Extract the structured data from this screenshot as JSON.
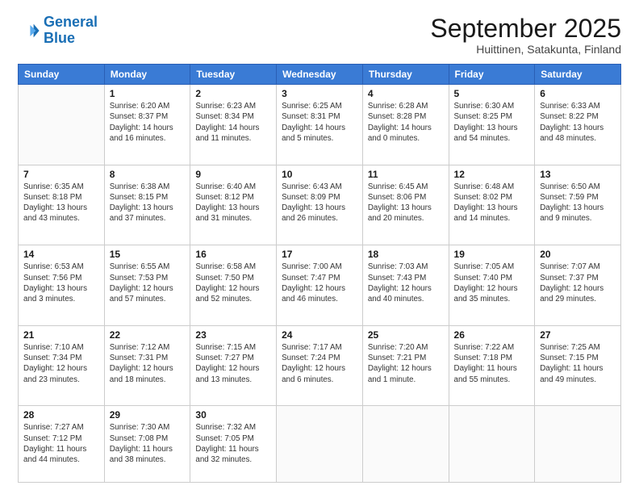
{
  "logo": {
    "line1": "General",
    "line2": "Blue"
  },
  "title": "September 2025",
  "subtitle": "Huittinen, Satakunta, Finland",
  "weekdays": [
    "Sunday",
    "Monday",
    "Tuesday",
    "Wednesday",
    "Thursday",
    "Friday",
    "Saturday"
  ],
  "weeks": [
    [
      {
        "day": "",
        "info": ""
      },
      {
        "day": "1",
        "info": "Sunrise: 6:20 AM\nSunset: 8:37 PM\nDaylight: 14 hours\nand 16 minutes."
      },
      {
        "day": "2",
        "info": "Sunrise: 6:23 AM\nSunset: 8:34 PM\nDaylight: 14 hours\nand 11 minutes."
      },
      {
        "day": "3",
        "info": "Sunrise: 6:25 AM\nSunset: 8:31 PM\nDaylight: 14 hours\nand 5 minutes."
      },
      {
        "day": "4",
        "info": "Sunrise: 6:28 AM\nSunset: 8:28 PM\nDaylight: 14 hours\nand 0 minutes."
      },
      {
        "day": "5",
        "info": "Sunrise: 6:30 AM\nSunset: 8:25 PM\nDaylight: 13 hours\nand 54 minutes."
      },
      {
        "day": "6",
        "info": "Sunrise: 6:33 AM\nSunset: 8:22 PM\nDaylight: 13 hours\nand 48 minutes."
      }
    ],
    [
      {
        "day": "7",
        "info": "Sunrise: 6:35 AM\nSunset: 8:18 PM\nDaylight: 13 hours\nand 43 minutes."
      },
      {
        "day": "8",
        "info": "Sunrise: 6:38 AM\nSunset: 8:15 PM\nDaylight: 13 hours\nand 37 minutes."
      },
      {
        "day": "9",
        "info": "Sunrise: 6:40 AM\nSunset: 8:12 PM\nDaylight: 13 hours\nand 31 minutes."
      },
      {
        "day": "10",
        "info": "Sunrise: 6:43 AM\nSunset: 8:09 PM\nDaylight: 13 hours\nand 26 minutes."
      },
      {
        "day": "11",
        "info": "Sunrise: 6:45 AM\nSunset: 8:06 PM\nDaylight: 13 hours\nand 20 minutes."
      },
      {
        "day": "12",
        "info": "Sunrise: 6:48 AM\nSunset: 8:02 PM\nDaylight: 13 hours\nand 14 minutes."
      },
      {
        "day": "13",
        "info": "Sunrise: 6:50 AM\nSunset: 7:59 PM\nDaylight: 13 hours\nand 9 minutes."
      }
    ],
    [
      {
        "day": "14",
        "info": "Sunrise: 6:53 AM\nSunset: 7:56 PM\nDaylight: 13 hours\nand 3 minutes."
      },
      {
        "day": "15",
        "info": "Sunrise: 6:55 AM\nSunset: 7:53 PM\nDaylight: 12 hours\nand 57 minutes."
      },
      {
        "day": "16",
        "info": "Sunrise: 6:58 AM\nSunset: 7:50 PM\nDaylight: 12 hours\nand 52 minutes."
      },
      {
        "day": "17",
        "info": "Sunrise: 7:00 AM\nSunset: 7:47 PM\nDaylight: 12 hours\nand 46 minutes."
      },
      {
        "day": "18",
        "info": "Sunrise: 7:03 AM\nSunset: 7:43 PM\nDaylight: 12 hours\nand 40 minutes."
      },
      {
        "day": "19",
        "info": "Sunrise: 7:05 AM\nSunset: 7:40 PM\nDaylight: 12 hours\nand 35 minutes."
      },
      {
        "day": "20",
        "info": "Sunrise: 7:07 AM\nSunset: 7:37 PM\nDaylight: 12 hours\nand 29 minutes."
      }
    ],
    [
      {
        "day": "21",
        "info": "Sunrise: 7:10 AM\nSunset: 7:34 PM\nDaylight: 12 hours\nand 23 minutes."
      },
      {
        "day": "22",
        "info": "Sunrise: 7:12 AM\nSunset: 7:31 PM\nDaylight: 12 hours\nand 18 minutes."
      },
      {
        "day": "23",
        "info": "Sunrise: 7:15 AM\nSunset: 7:27 PM\nDaylight: 12 hours\nand 13 minutes."
      },
      {
        "day": "24",
        "info": "Sunrise: 7:17 AM\nSunset: 7:24 PM\nDaylight: 12 hours\nand 6 minutes."
      },
      {
        "day": "25",
        "info": "Sunrise: 7:20 AM\nSunset: 7:21 PM\nDaylight: 12 hours\nand 1 minute."
      },
      {
        "day": "26",
        "info": "Sunrise: 7:22 AM\nSunset: 7:18 PM\nDaylight: 11 hours\nand 55 minutes."
      },
      {
        "day": "27",
        "info": "Sunrise: 7:25 AM\nSunset: 7:15 PM\nDaylight: 11 hours\nand 49 minutes."
      }
    ],
    [
      {
        "day": "28",
        "info": "Sunrise: 7:27 AM\nSunset: 7:12 PM\nDaylight: 11 hours\nand 44 minutes."
      },
      {
        "day": "29",
        "info": "Sunrise: 7:30 AM\nSunset: 7:08 PM\nDaylight: 11 hours\nand 38 minutes."
      },
      {
        "day": "30",
        "info": "Sunrise: 7:32 AM\nSunset: 7:05 PM\nDaylight: 11 hours\nand 32 minutes."
      },
      {
        "day": "",
        "info": ""
      },
      {
        "day": "",
        "info": ""
      },
      {
        "day": "",
        "info": ""
      },
      {
        "day": "",
        "info": ""
      }
    ]
  ]
}
